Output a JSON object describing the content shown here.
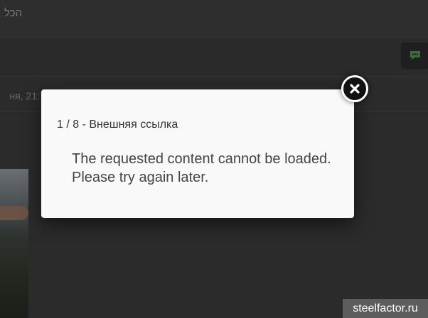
{
  "background": {
    "page_title": "הכל",
    "date_fragment": "ня, 21:",
    "chat_icon": "chat-bubble-icon"
  },
  "modal": {
    "title": "1 / 8 - Внешняя ссылка",
    "message_line1": "The requested content cannot be loaded.",
    "message_line2": "Please try again later.",
    "close_icon": "close-icon"
  },
  "watermark": "steelfactor.ru",
  "colors": {
    "overlay": "#2b2b2b",
    "modal_bg": "#f9f9f9",
    "close_button": "#111111",
    "chat_icon": "#3e6b3c",
    "watermark_bg": "#5d5d5d"
  }
}
